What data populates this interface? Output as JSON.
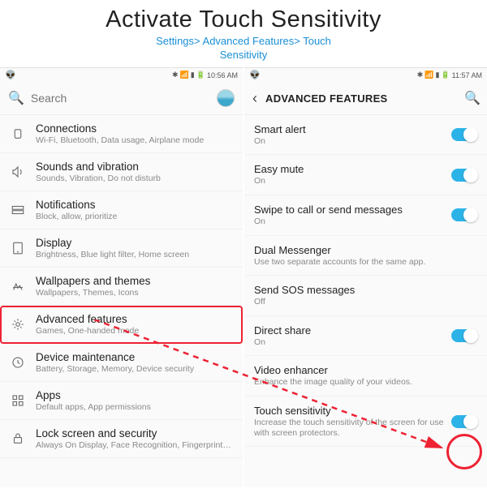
{
  "title": "Activate Touch Sensitivity",
  "breadcrumb_line1": "Settings> Advanced Features> Touch",
  "breadcrumb_line2": "Sensitivity",
  "left": {
    "time": "10:56 AM",
    "search_placeholder": "Search",
    "items": [
      {
        "title": "Connections",
        "sub": "Wi-Fi, Bluetooth, Data usage, Airplane mode"
      },
      {
        "title": "Sounds and vibration",
        "sub": "Sounds, Vibration, Do not disturb"
      },
      {
        "title": "Notifications",
        "sub": "Block, allow, prioritize"
      },
      {
        "title": "Display",
        "sub": "Brightness, Blue light filter, Home screen"
      },
      {
        "title": "Wallpapers and themes",
        "sub": "Wallpapers, Themes, Icons"
      },
      {
        "title": "Advanced features",
        "sub": "Games, One-handed mode"
      },
      {
        "title": "Device maintenance",
        "sub": "Battery, Storage, Memory, Device security"
      },
      {
        "title": "Apps",
        "sub": "Default apps, App permissions"
      },
      {
        "title": "Lock screen and security",
        "sub": "Always On Display, Face Recognition, Fingerprints, Iris"
      }
    ]
  },
  "right": {
    "time": "11:57 AM",
    "header": "ADVANCED FEATURES",
    "items": [
      {
        "title": "Smart alert",
        "sub": "On",
        "toggle": "on"
      },
      {
        "title": "Easy mute",
        "sub": "On",
        "toggle": "on"
      },
      {
        "title": "Swipe to call or send messages",
        "sub": "On",
        "toggle": "on"
      },
      {
        "title": "Dual Messenger",
        "sub": "Use two separate accounts for the same app.",
        "toggle": ""
      },
      {
        "title": "Send SOS messages",
        "sub": "Off",
        "toggle": ""
      },
      {
        "title": "Direct share",
        "sub": "On",
        "toggle": "on"
      },
      {
        "title": "Video enhancer",
        "sub": "Enhance the image quality of your videos.",
        "toggle": ""
      },
      {
        "title": "Touch sensitivity",
        "sub": "Increase the touch sensitivity of the screen for use with screen protectors.",
        "toggle": "on"
      }
    ]
  }
}
